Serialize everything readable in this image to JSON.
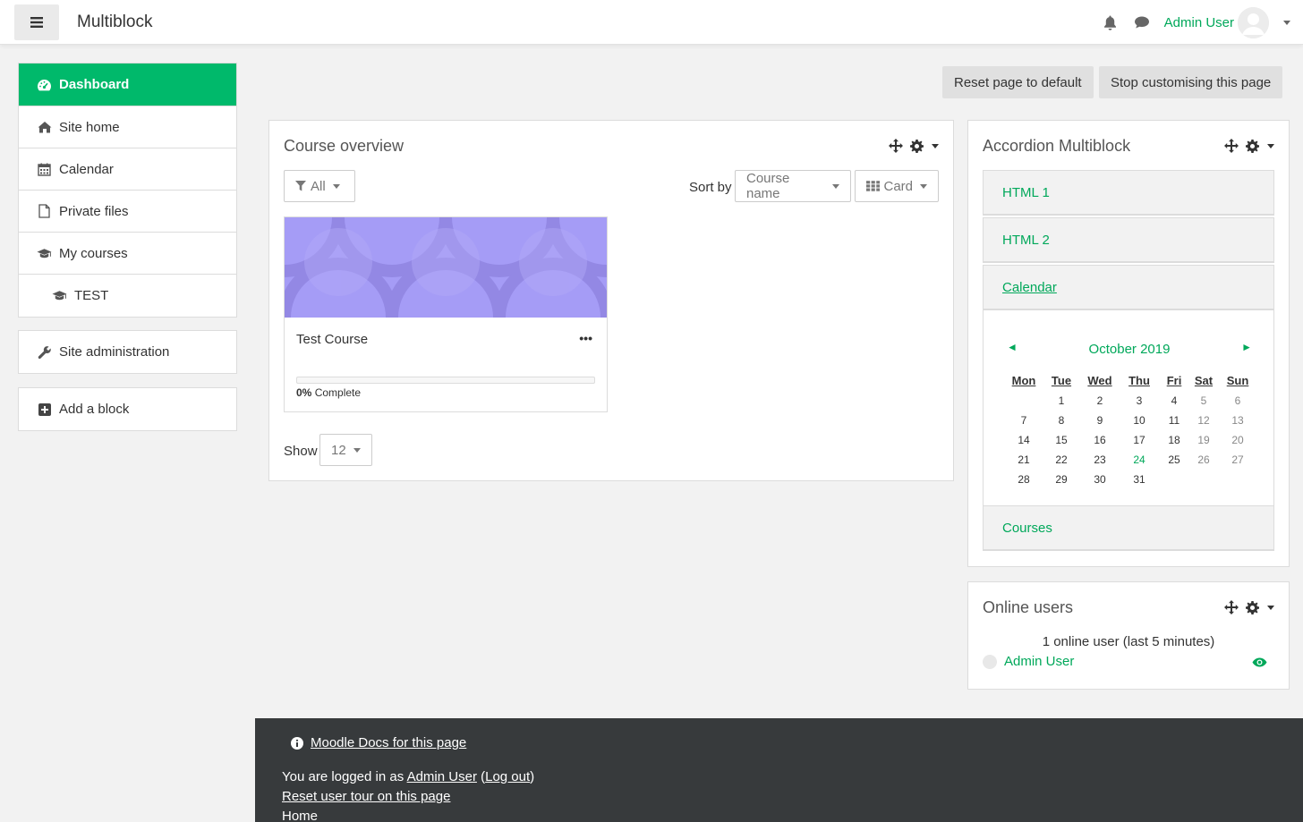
{
  "navbar": {
    "site_name": "Multiblock",
    "user_name": "Admin User"
  },
  "drawer": {
    "items": [
      {
        "label": "Dashboard",
        "icon": "dashboard-icon"
      },
      {
        "label": "Site home",
        "icon": "home-icon"
      },
      {
        "label": "Calendar",
        "icon": "calendar-icon"
      },
      {
        "label": "Private files",
        "icon": "file-icon"
      },
      {
        "label": "My courses",
        "icon": "graduation-cap-icon"
      },
      {
        "label": "TEST",
        "icon": "graduation-cap-icon"
      }
    ],
    "site_admin": "Site administration",
    "add_block": "Add a block"
  },
  "main": {
    "reset_btn": "Reset page to default",
    "stop_btn": "Stop customising this page"
  },
  "course_overview": {
    "title": "Course overview",
    "filter": "All",
    "sort_by_label": "Sort by",
    "sort_value": "Course name",
    "view_value": "Card",
    "course": {
      "name": "Test Course",
      "progress_percent": 0,
      "progress_label": "0%",
      "complete_label": "Complete"
    },
    "show_label": "Show",
    "show_value": "12"
  },
  "accordion": {
    "title": "Accordion Multiblock",
    "items": [
      "HTML 1",
      "HTML 2",
      "Calendar",
      "Courses"
    ],
    "calendar": {
      "month": "October 2019",
      "prev": "◄",
      "next": "►",
      "days": [
        "Mon",
        "Tue",
        "Wed",
        "Thu",
        "Fri",
        "Sat",
        "Sun"
      ],
      "weeks": [
        [
          "",
          "1",
          "2",
          "3",
          "4",
          "5",
          "6"
        ],
        [
          "7",
          "8",
          "9",
          "10",
          "11",
          "12",
          "13"
        ],
        [
          "14",
          "15",
          "16",
          "17",
          "18",
          "19",
          "20"
        ],
        [
          "21",
          "22",
          "23",
          "24",
          "25",
          "26",
          "27"
        ],
        [
          "28",
          "29",
          "30",
          "31",
          "",
          "",
          ""
        ]
      ],
      "today": "24"
    }
  },
  "online_users": {
    "title": "Online users",
    "count_text": "1 online user (last 5 minutes)",
    "user": "Admin User"
  },
  "footer": {
    "docs_link": "Moodle Docs for this page",
    "logged_in_prefix": "You are logged in as",
    "logged_in_user": "Admin User",
    "logout_open": "(",
    "logout": "Log out",
    "logout_close": ")",
    "reset_tour": "Reset user tour on this page",
    "home": "Home"
  },
  "colors": {
    "accent": "#00b96b",
    "link": "#00a85a",
    "footer_bg": "#373a3c"
  }
}
